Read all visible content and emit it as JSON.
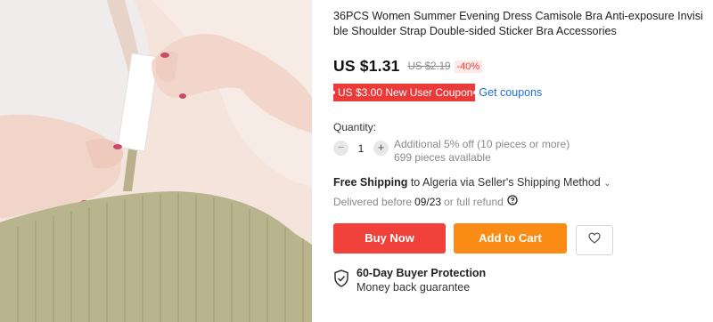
{
  "product": {
    "title": "36PCS Women Summer Evening Dress Camisole Bra Anti-exposure Invisible Shoulder Strap Double-sided Sticker Bra Accessories",
    "image_alt": "Woman applying double-sided sticker to camisole strap"
  },
  "pricing": {
    "price": "US $1.31",
    "original_price": "US $2.19",
    "discount": "-40%"
  },
  "coupon": {
    "label": "US $3.00 New User Coupon",
    "link": "Get coupons"
  },
  "quantity": {
    "label": "Quantity:",
    "minus_icon": "minus-icon",
    "plus_icon": "plus-icon",
    "value": "1",
    "offer_note": "Additional 5% off (10 pieces or more)",
    "available": "699 pieces available"
  },
  "shipping": {
    "free_label": "Free Shipping",
    "destination_text": "to Algeria via Seller's Shipping Method",
    "chevron": "⌄",
    "delivered_prefix": "Delivered before",
    "delivered_date": "09/23",
    "delivered_suffix": "or full refund"
  },
  "actions": {
    "buy_now": "Buy Now",
    "add_to_cart": "Add to Cart",
    "wishlist_icon": "heart-icon"
  },
  "protection": {
    "icon": "shield-check-icon",
    "title": "60-Day Buyer Protection",
    "subtitle": "Money back guarantee"
  },
  "colors": {
    "price_red": "#f0413a",
    "cart_orange": "#fa8c16",
    "coupon_red": "#ea3a3a",
    "link_blue": "#1f6fd6",
    "fabric_olive": "#b8b48d"
  }
}
